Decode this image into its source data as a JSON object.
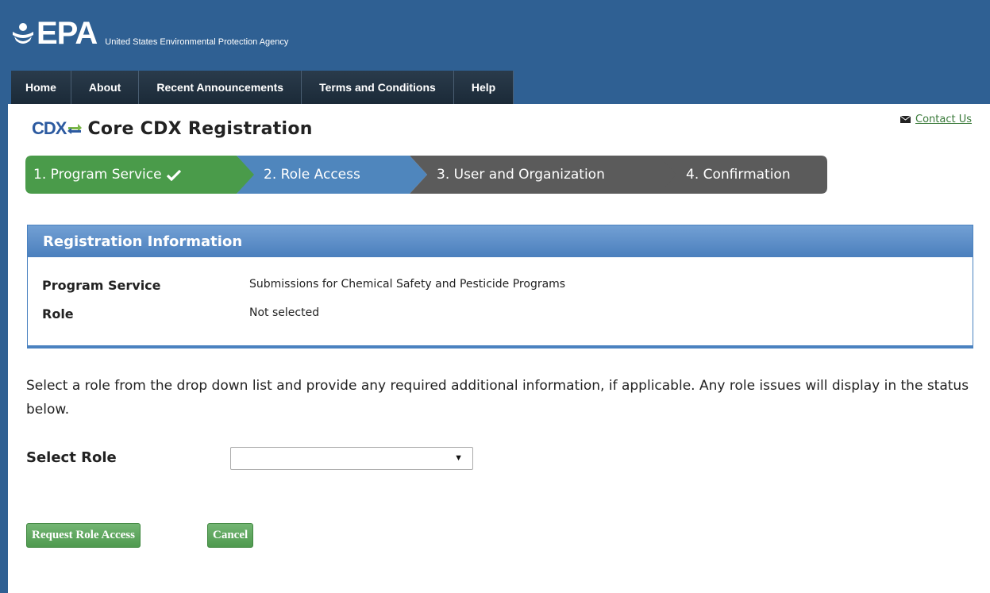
{
  "header": {
    "logo_text": "EPA",
    "agency_name": "United States Environmental Protection Agency"
  },
  "nav": [
    {
      "label": "Home"
    },
    {
      "label": "About"
    },
    {
      "label": "Recent Announcements"
    },
    {
      "label": "Terms and Conditions"
    },
    {
      "label": "Help"
    }
  ],
  "page": {
    "logo_text": "CDX",
    "title": "Core CDX Registration",
    "contact_link": "Contact Us"
  },
  "steps": [
    {
      "label": "1. Program Service",
      "status": "complete",
      "color": "#4a9b4a"
    },
    {
      "label": "2. Role Access",
      "status": "current",
      "color": "#4f86bd"
    },
    {
      "label": "3. User and Organization",
      "status": "pending",
      "color": "#5b5b5b"
    },
    {
      "label": "4. Confirmation",
      "status": "pending",
      "color": "#5b5b5b"
    }
  ],
  "registration_info": {
    "heading": "Registration Information",
    "rows": [
      {
        "key": "Program Service",
        "value": "Submissions for Chemical Safety and Pesticide Programs"
      },
      {
        "key": "Role",
        "value": "Not selected"
      }
    ]
  },
  "instructions": "Select a role from the drop down list and provide any required additional information, if applicable. Any role issues will display in the status below.",
  "role_select": {
    "label": "Select Role",
    "value": ""
  },
  "buttons": {
    "request": "Request Role Access",
    "cancel": "Cancel"
  }
}
